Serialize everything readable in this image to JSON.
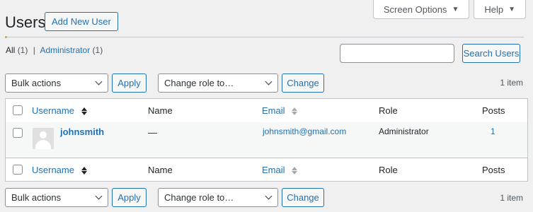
{
  "screen_tabs": [
    {
      "label": "Screen Options",
      "icon": "caret-down-icon"
    },
    {
      "label": "Help",
      "icon": "caret-down-icon"
    }
  ],
  "header": {
    "title": "Users",
    "add_new_label": "Add New User"
  },
  "filters": [
    {
      "label": "All",
      "count": "(1)",
      "current": true
    },
    {
      "label": "Administrator",
      "count": "(1)",
      "current": false
    }
  ],
  "search": {
    "button_label": "Search Users",
    "value": ""
  },
  "tablenav_top": {
    "bulk_actions": "Bulk actions",
    "apply_label": "Apply",
    "change_role": "Change role to…",
    "change_label": "Change",
    "items_count": "1 item"
  },
  "tablenav_bottom": {
    "bulk_actions": "Bulk actions",
    "apply_label": "Apply",
    "change_role": "Change role to…",
    "change_label": "Change",
    "items_count": "1 item"
  },
  "table": {
    "columns": {
      "username": "Username",
      "name": "Name",
      "email": "Email",
      "role": "Role",
      "posts": "Posts"
    },
    "rows": [
      {
        "username": "johnsmith",
        "name": "—",
        "email": "johnsmith@gmail.com",
        "role": "Administrator",
        "posts": "1"
      }
    ]
  }
}
